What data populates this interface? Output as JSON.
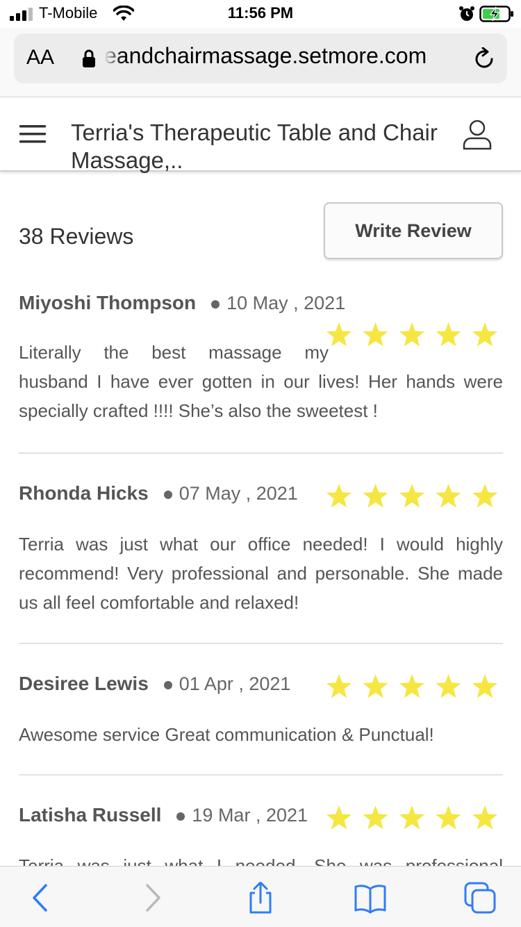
{
  "status_bar": {
    "carrier": "T-Mobile",
    "time": "11:56 PM",
    "icons": [
      "signal-icon",
      "wifi-icon",
      "alarm-icon",
      "battery-charging-icon"
    ]
  },
  "browser": {
    "text_size_button": "AA",
    "url": "eandchairmassage.setmore.com",
    "icons": [
      "lock-icon",
      "reload-icon"
    ]
  },
  "site_header": {
    "title": "Terria's Therapeutic Table and Chair Massage,..",
    "icons": [
      "hamburger-menu-icon",
      "user-icon"
    ]
  },
  "reviews_summary": {
    "count_label": "38 Reviews",
    "write_review_label": "Write Review"
  },
  "reviews": [
    {
      "name": "Miyoshi Thompson",
      "date": "10 May , 2021",
      "rating": 5,
      "text": "Literally the best massage my husband I have ever gotten in our lives! Her hands were specially crafted !!!! She’s also the sweetest !"
    },
    {
      "name": "Rhonda Hicks",
      "date": "07 May , 2021",
      "rating": 5,
      "text": "Terria was just what our office needed! I would highly recommend! Very professional and personable. She made us all feel comfortable and relaxed!"
    },
    {
      "name": "Desiree Lewis",
      "date": "01 Apr , 2021",
      "rating": 5,
      "text": "Awesome service Great communication & Punctual!"
    },
    {
      "name": "Latisha Russell",
      "date": "19 Mar , 2021",
      "rating": 5,
      "text": "Terria was just what I needed. She was professional"
    }
  ],
  "colors": {
    "star": "#f5e642",
    "accent": "#2f7cf6"
  },
  "toolbar": {
    "icons": [
      "back-icon",
      "forward-icon",
      "share-icon",
      "bookmarks-icon",
      "tabs-icon"
    ]
  }
}
